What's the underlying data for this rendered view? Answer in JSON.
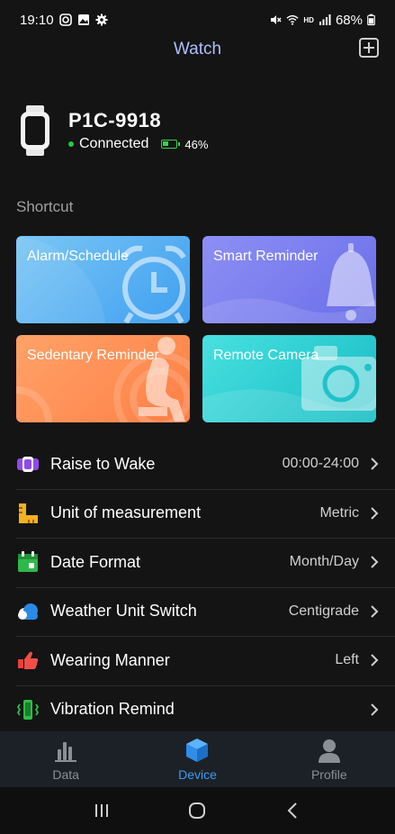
{
  "status_bar": {
    "time": "19:10",
    "battery": "68%"
  },
  "header": {
    "title": "Watch"
  },
  "device": {
    "name": "P1C-9918",
    "status": "Connected",
    "battery": "46%",
    "battery_level": 0.46
  },
  "shortcut": {
    "title": "Shortcut",
    "tiles": [
      {
        "label": "Alarm/Schedule",
        "icon": "alarm-clock-icon",
        "color": "#4fa9f2"
      },
      {
        "label": "Smart Reminder",
        "icon": "bell-icon",
        "color": "#7a7df0"
      },
      {
        "label": "Sedentary Reminder",
        "icon": "sitting-person-icon",
        "color": "#ff8f55"
      },
      {
        "label": "Remote Camera",
        "icon": "camera-icon",
        "color": "#2ccfd2"
      }
    ]
  },
  "settings": [
    {
      "label": "Raise to Wake",
      "value": "00:00-24:00",
      "icon": "raise-wrist-icon"
    },
    {
      "label": "Unit of measurement",
      "value": "Metric",
      "icon": "ruler-icon"
    },
    {
      "label": "Date Format",
      "value": "Month/Day",
      "icon": "calendar-icon"
    },
    {
      "label": "Weather Unit Switch",
      "value": "Centigrade",
      "icon": "cloud-icon"
    },
    {
      "label": "Wearing Manner",
      "value": "Left",
      "icon": "hand-icon"
    },
    {
      "label": "Vibration Remind",
      "value": "",
      "icon": "vibration-icon"
    }
  ],
  "bottom_nav": [
    {
      "label": "Data",
      "icon": "bar-chart-icon",
      "active": false
    },
    {
      "label": "Device",
      "icon": "cube-icon",
      "active": true
    },
    {
      "label": "Profile",
      "icon": "person-icon",
      "active": false
    }
  ],
  "colors": {
    "accent": "#3d9af0",
    "header_title": "#aebeff",
    "connected": "#28c840"
  }
}
